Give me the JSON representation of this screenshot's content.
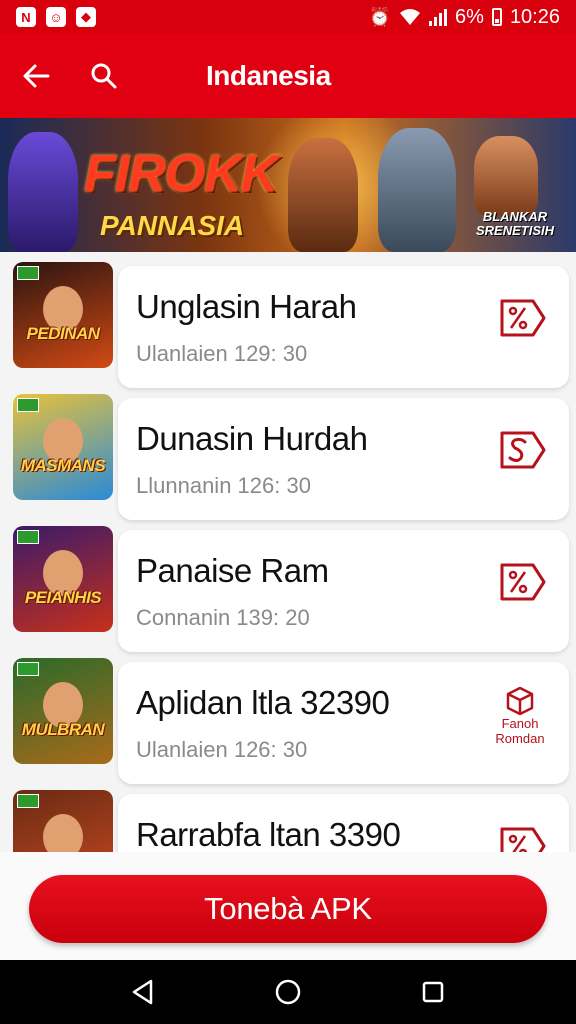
{
  "status_bar": {
    "battery": "6%",
    "time": "10:26",
    "icons": [
      "n-app-icon",
      "face-app-icon",
      "tag-app-icon",
      "alarm-icon",
      "wifi-icon",
      "signal-icon",
      "battery-icon"
    ]
  },
  "app_bar": {
    "title": "Indanesia",
    "icons": [
      "back-arrow-icon",
      "search-icon"
    ]
  },
  "banner": {
    "title_line1": "FIROKK",
    "title_line2": "PANNASIA",
    "side_text_line1": "BLANKAR",
    "side_text_line2": "SRENETISIH"
  },
  "items": [
    {
      "thumb_label": "PEDINAN",
      "thumb_colors": [
        "#2a1410",
        "#d24a14"
      ],
      "title": "Unglasin Harah",
      "subtitle": "Ulanlaien 129: 30",
      "action_icon": "discount-tag-icon"
    },
    {
      "thumb_label": "MASMANS",
      "thumb_colors": [
        "#e8c23a",
        "#2a8ad8"
      ],
      "title": "Dunasin Hurdah",
      "subtitle": "Llunnanin 126: 30",
      "action_icon": "s-tag-icon"
    },
    {
      "thumb_label": "PEIANHIS",
      "thumb_colors": [
        "#3a1a6a",
        "#c8301a"
      ],
      "title": "Panaise Ram",
      "subtitle": "Connanin 139: 20",
      "action_icon": "discount-tag-icon"
    },
    {
      "thumb_label": "MULBRAN",
      "thumb_colors": [
        "#2a6a2a",
        "#a86a1a"
      ],
      "title": "Aplidan ltla 32390",
      "subtitle": "Ulanlaien 126: 30",
      "action_icon": "box-icon",
      "action_text_line1": "Fanoh",
      "action_text_line2": "Romdan"
    },
    {
      "thumb_label": "",
      "thumb_colors": [
        "#6a2a14",
        "#c84a20"
      ],
      "title": "Rarrabfa ltan 3390",
      "subtitle": "",
      "action_icon": "discount-tag-icon"
    }
  ],
  "download_button": {
    "label": "Tonebà APK"
  },
  "nav_bar": {
    "icons": [
      "back-triangle-icon",
      "home-circle-icon",
      "recents-square-icon"
    ]
  },
  "colors": {
    "primary": "#e00012",
    "action_icon": "#b6121b"
  }
}
